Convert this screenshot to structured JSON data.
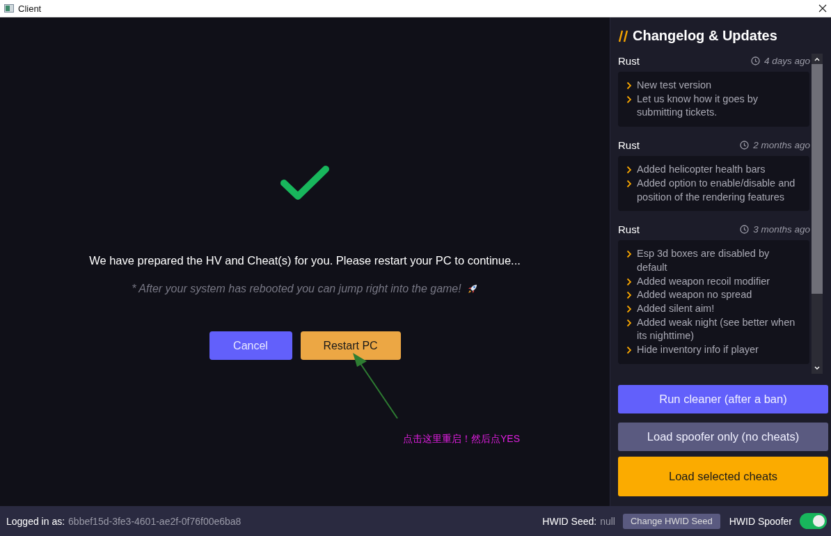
{
  "window": {
    "title": "Client"
  },
  "main": {
    "message": "We have prepared the HV and Cheat(s) for you. Please restart your PC to continue...",
    "note": "* After your system has rebooted you can jump right into the game!",
    "buttons": [
      {
        "label": "Cancel",
        "kind": "secondary"
      },
      {
        "label": "Restart PC",
        "kind": "primary"
      }
    ],
    "annotation": "点击这里重启！然后点YES"
  },
  "changelog": {
    "title": "Changelog & Updates",
    "entries": [
      {
        "game": "Rust",
        "time": "4 days ago",
        "items": [
          "New test version",
          "Let us know how it goes by submitting tickets."
        ]
      },
      {
        "game": "Rust",
        "time": "2 months ago",
        "items": [
          "Added helicopter health bars",
          "Added option to enable/disable and position of the rendering features"
        ]
      },
      {
        "game": "Rust",
        "time": "3 months ago",
        "items": [
          "Esp 3d boxes are disabled by default",
          "Added weapon recoil modifier",
          "Added weapon no spread",
          "Added silent aim!",
          "Added weak night (see better when its nighttime)",
          "Hide inventory info if player"
        ]
      }
    ]
  },
  "actions": [
    {
      "label": "Run cleaner (after a ban)",
      "kind": "blue"
    },
    {
      "label": "Load spoofer only (no cheats)",
      "kind": "grey"
    },
    {
      "label": "Load selected cheats",
      "kind": "orange"
    }
  ],
  "status_bar": {
    "logged_label": "Logged in as:",
    "user_id": "6bbef15d-3fe3-4601-ae2f-0f76f00e6ba8",
    "seed_label": "HWID Seed:",
    "seed_value": "null",
    "change_seed": "Change HWID Seed",
    "spoofer_label": "HWID Spoofer",
    "spoofer_on": true
  }
}
